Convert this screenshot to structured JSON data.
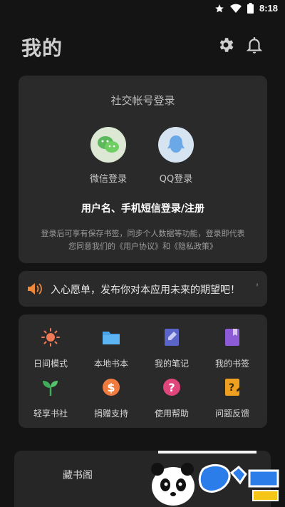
{
  "status": {
    "time": "8:18"
  },
  "header": {
    "title": "我的"
  },
  "login": {
    "title": "社交帐号登录",
    "wechat_label": "微信登录",
    "qq_label": "QQ登录",
    "username_login": "用户名、手机短信登录/注册",
    "agreement_line1": "登录后可享有保存书签，同步个人数据等功能，登录即代表",
    "agreement_line2": "您同意我们的《用户协议》和《隐私政策》"
  },
  "notice": {
    "text": "入心愿单，发布你对本应用未来的期望吧！",
    "trailing": "'"
  },
  "grid": [
    {
      "label": "日间模式",
      "icon": "sun-icon"
    },
    {
      "label": "本地书本",
      "icon": "folder-icon"
    },
    {
      "label": "我的笔记",
      "icon": "note-icon"
    },
    {
      "label": "我的书签",
      "icon": "bookmark-icon"
    },
    {
      "label": "轻享书社",
      "icon": "sprout-icon"
    },
    {
      "label": "捐赠支持",
      "icon": "dollar-icon"
    },
    {
      "label": "使用帮助",
      "icon": "help-icon"
    },
    {
      "label": "问题反馈",
      "icon": "feedback-icon"
    }
  ],
  "bottom": {
    "label": "藏书阁"
  },
  "colors": {
    "background": "#141414",
    "card": "#2a2a2a",
    "accent_orange": "#f0883a",
    "accent_blue": "#4aa3e8",
    "accent_purple": "#8e5bd6",
    "accent_pink": "#e0457b"
  }
}
